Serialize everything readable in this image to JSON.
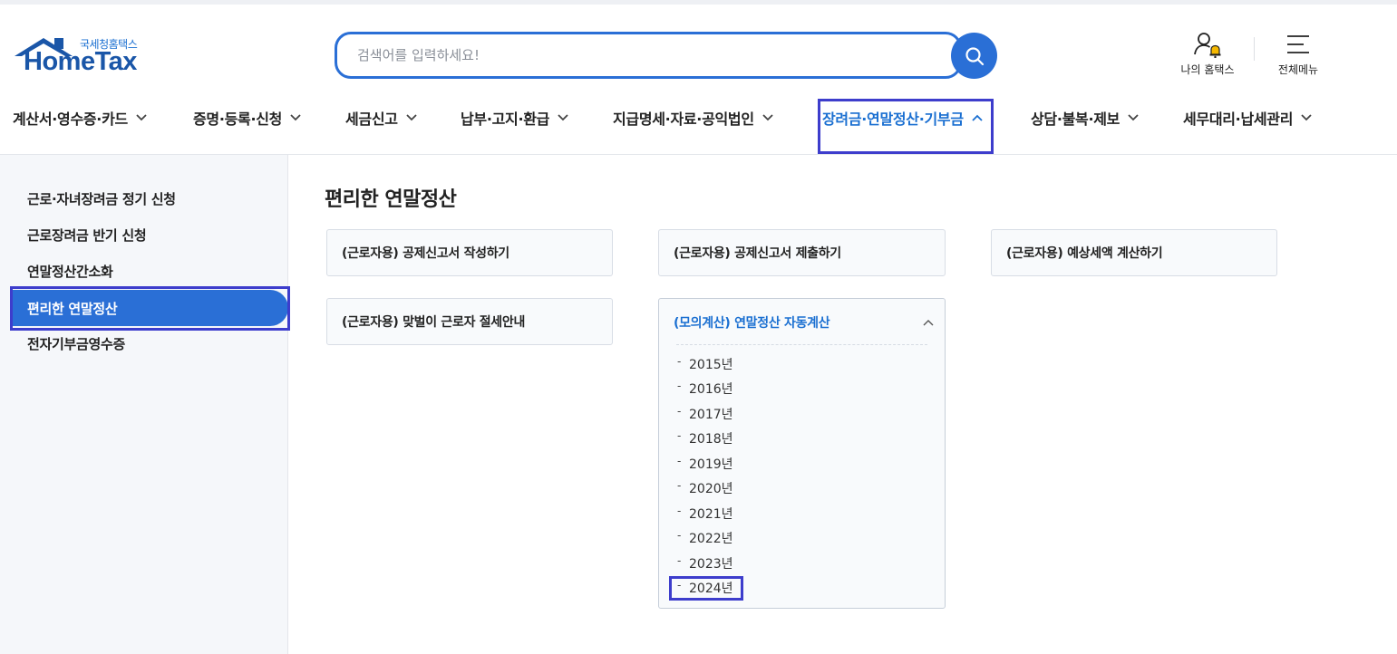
{
  "header": {
    "logo_sub": "국세청홈택스",
    "logo_main": "HomeTax",
    "search_placeholder": "검색어를 입력하세요!",
    "my_hometax": "나의 홈택스",
    "all_menu": "전체메뉴"
  },
  "gnb": {
    "items": [
      {
        "label": "계산서·영수증·카드"
      },
      {
        "label": "증명·등록·신청"
      },
      {
        "label": "세금신고"
      },
      {
        "label": "납부·고지·환급"
      },
      {
        "label": "지급명세·자료·공익법인"
      },
      {
        "label": "장려금·연말정산·기부금"
      },
      {
        "label": "상담·불복·제보"
      },
      {
        "label": "세무대리·납세관리"
      }
    ]
  },
  "side": {
    "items": [
      {
        "label": "근로·자녀장려금 정기 신청"
      },
      {
        "label": "근로장려금 반기 신청"
      },
      {
        "label": "연말정산간소화"
      },
      {
        "label": "편리한 연말정산"
      },
      {
        "label": "전자기부금영수증"
      }
    ]
  },
  "main": {
    "title": "편리한 연말정산",
    "cards": [
      {
        "label": "(근로자용) 공제신고서 작성하기"
      },
      {
        "label": "(근로자용) 공제신고서 제출하기"
      },
      {
        "label": "(근로자용) 예상세액 계산하기"
      },
      {
        "label": "(근로자용) 맞벌이 근로자 절세안내"
      }
    ],
    "accordion": {
      "title": "(모의계산) 연말정산 자동계산",
      "years": [
        "2015년",
        "2016년",
        "2017년",
        "2018년",
        "2019년",
        "2020년",
        "2021년",
        "2022년",
        "2023년",
        "2024년"
      ]
    }
  },
  "colors": {
    "brand_blue": "#2a6fd6",
    "active_text": "#1a6fd1",
    "highlight_box": "#3d3dcc"
  },
  "icons": {
    "search": "search-icon",
    "my_hometax": "user-bell-icon",
    "all_menu": "hamburger-icon",
    "chevron": "chevron-down-icon"
  }
}
